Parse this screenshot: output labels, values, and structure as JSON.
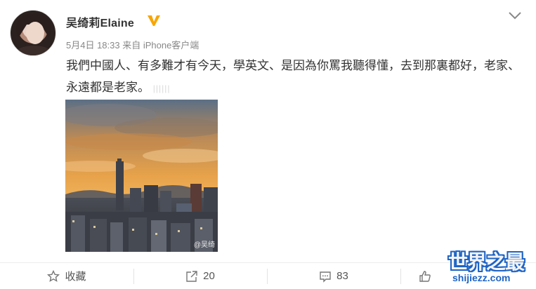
{
  "post": {
    "username": "吴绮莉Elaine",
    "verified_badge_icon": "verified-v-icon",
    "meta": "5月4日 18:33 来自 iPhone客户端",
    "text_main": "我們中國人、有多難才有今天，學英文、是因為你罵我聽得懂，去到那裏都好，老家、永遠都是老家。",
    "text_faint": "||||||",
    "photo_watermark": "@吴绮",
    "colors": {
      "accent_orange": "#f7a600",
      "link_blue": "#1e64c6"
    }
  },
  "actions": {
    "favorite": {
      "icon": "star-outline-icon",
      "label": "收藏"
    },
    "repost": {
      "icon": "share-arrow-icon",
      "count": "20"
    },
    "comment": {
      "icon": "comment-bubble-icon",
      "count": "83"
    },
    "like": {
      "icon": "thumbs-up-icon"
    }
  },
  "site_logo": {
    "title": "世界之最",
    "domain": "shijiezz.com"
  }
}
